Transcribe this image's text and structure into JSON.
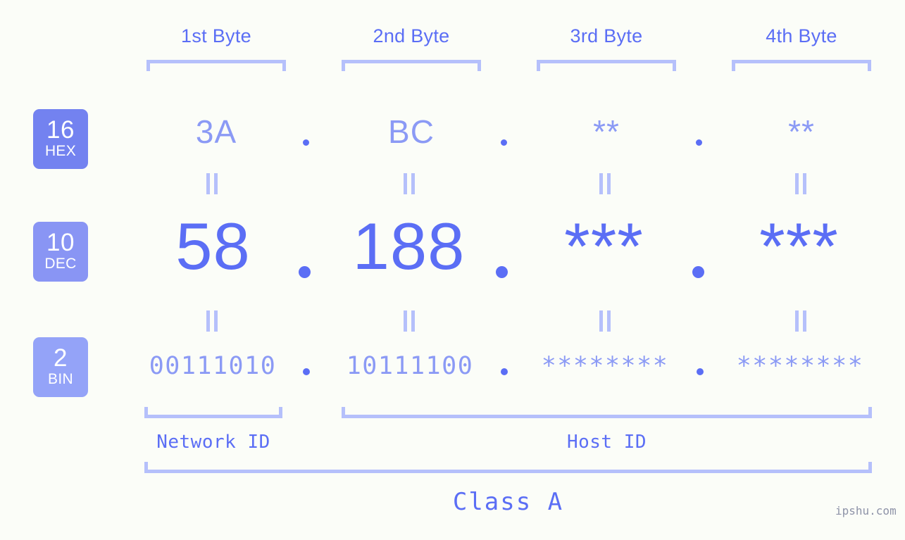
{
  "theme": {
    "background": "#fbfdf8",
    "primary": "#5b6ef5",
    "secondary": "#8b9af5",
    "bracket": "#b5c0fb",
    "badge_hex_bg": "#7382f0",
    "badge_dec_bg": "#8995f4",
    "badge_bin_bg": "#94a3f8",
    "watermark": "#8e93a8"
  },
  "headers": [
    {
      "label": "1st Byte"
    },
    {
      "label": "2nd Byte"
    },
    {
      "label": "3rd Byte"
    },
    {
      "label": "4th Byte"
    }
  ],
  "rows": [
    {
      "badge": {
        "number": "16",
        "name": "HEX"
      },
      "values": [
        "3A",
        "BC",
        "**",
        "**"
      ],
      "separator": "."
    },
    {
      "badge": {
        "number": "10",
        "name": "DEC"
      },
      "values": [
        "58",
        "188",
        "***",
        "***"
      ],
      "separator": "."
    },
    {
      "badge": {
        "number": "2",
        "name": "BIN"
      },
      "values": [
        "00111010",
        "10111100",
        "********",
        "********"
      ],
      "separator": "."
    }
  ],
  "equals_marks": {
    "glyph": "||"
  },
  "footer": {
    "network_id": "Network ID",
    "host_id": "Host ID",
    "class": "Class A",
    "watermark": "ipshu.com"
  }
}
